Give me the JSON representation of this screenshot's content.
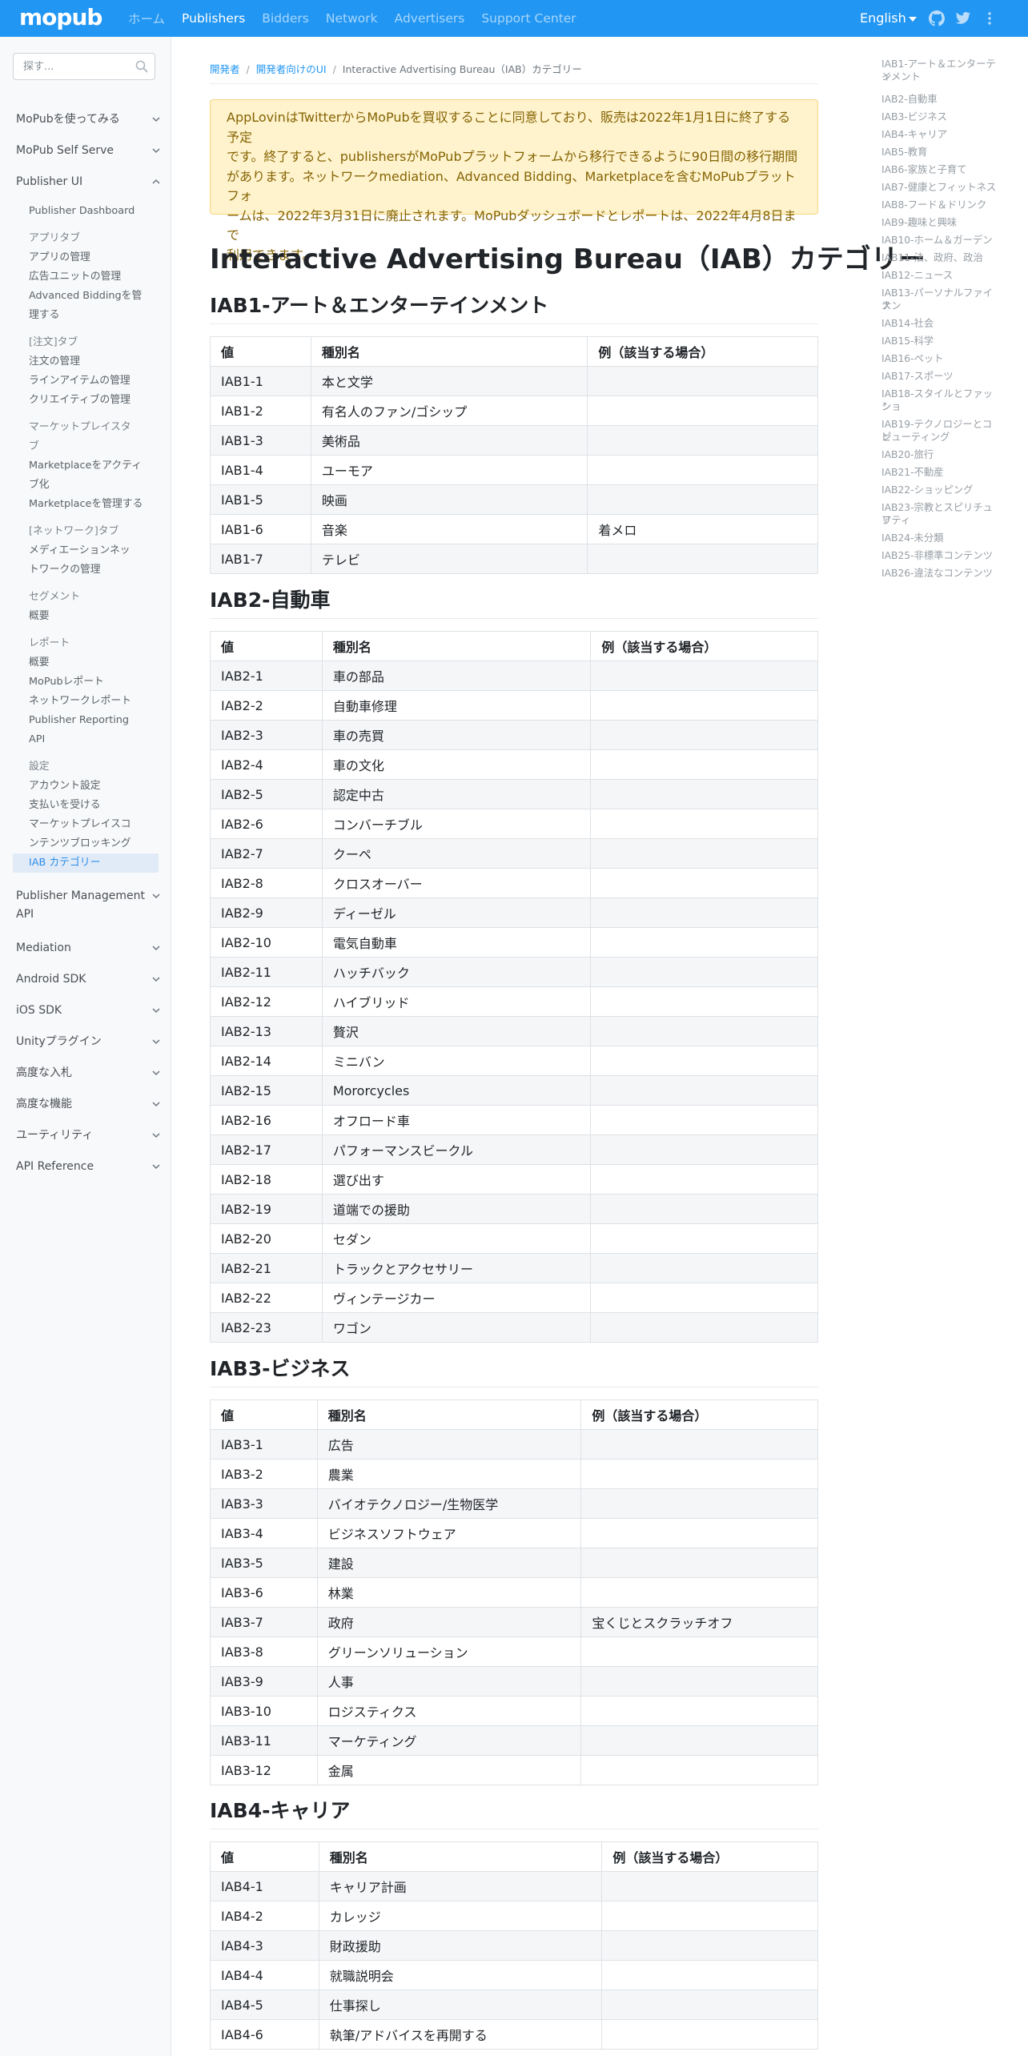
{
  "header": {
    "logo": "mopub",
    "nav": [
      "ホーム",
      "Publishers",
      "Bidders",
      "Network",
      "Advertisers",
      "Support Center"
    ],
    "active_nav": "Publishers",
    "language": "English",
    "icons": [
      "github-icon",
      "twitter-icon",
      "more-vertical-icon"
    ]
  },
  "sidebar": {
    "search_placeholder": "探す...",
    "sections_top": [
      "MoPubを使ってみる",
      "MoPub Self Serve",
      "Publisher UI"
    ],
    "items": [
      "Publisher Dashboard",
      "アプリタブ",
      "アプリの管理",
      "広告ユニットの管理",
      "Advanced Biddingを管",
      "理する",
      "[注文]タブ",
      "注文の管理",
      "ラインアイテムの管理",
      "クリエイティブの管理",
      "マーケットプレイスタ",
      "ブ",
      "Marketplaceをアクティ",
      "ブ化",
      "Marketplaceを管理する",
      "[ネットワーク]タブ",
      "メディエーションネッ",
      "トワークの管理",
      "セグメント",
      "概要",
      "レポート",
      "概要",
      "MoPubレポート",
      "ネットワークレポート",
      "Publisher Reporting",
      "API",
      "設定",
      "アカウント設定",
      "支払いを受ける",
      "マーケットプレイスコ",
      "ンテンツブロッキング",
      "IAB カテゴリー"
    ],
    "sections_bottom": [
      "Publisher Management",
      "API",
      "Mediation",
      "Android SDK",
      "iOS SDK",
      "Unityプラグイン",
      "高度な入札",
      "高度な機能",
      "ユーティリティ",
      "API Reference"
    ]
  },
  "breadcrumb": [
    "開発者",
    "開発者向けのUI",
    "Interactive Advertising Bureau（IAB）カテゴリー"
  ],
  "alert_lines": [
    "AppLovinはTwitterからMoPubを買収することに同意しており、販売は2022年1月1日に終了する予定",
    "です。終了すると、publishersがMoPubプラットフォームから移行できるように90日間の移行期間",
    "があります。ネットワークmediation、Advanced Bidding、Marketplaceを含むMoPubプラットフォ",
    "ームは、2022年3月31日に廃止されます。MoPubダッシュボードとレポートは、2022年4月8日まで",
    "利用できます。"
  ],
  "page_title": "Interactive Advertising Bureau（IAB）カテゴリー",
  "table_headers": [
    "値",
    "種別名",
    "例（該当する場合）"
  ],
  "tables": [
    {
      "title": "IAB1-アート＆エンターテインメント",
      "rows": [
        [
          "IAB1-1",
          "本と文学",
          ""
        ],
        [
          "IAB1-2",
          "有名人のファン/ゴシップ",
          ""
        ],
        [
          "IAB1-3",
          "美術品",
          ""
        ],
        [
          "IAB1-4",
          "ユーモア",
          ""
        ],
        [
          "IAB1-5",
          "映画",
          ""
        ],
        [
          "IAB1-6",
          "音楽",
          "着メロ"
        ],
        [
          "IAB1-7",
          "テレビ",
          ""
        ]
      ]
    },
    {
      "title": "IAB2-自動車",
      "rows": [
        [
          "IAB2-1",
          "車の部品",
          ""
        ],
        [
          "IAB2-2",
          "自動車修理",
          ""
        ],
        [
          "IAB2-3",
          "車の売買",
          ""
        ],
        [
          "IAB2-4",
          "車の文化",
          ""
        ],
        [
          "IAB2-5",
          "認定中古",
          ""
        ],
        [
          "IAB2-6",
          "コンバーチブル",
          ""
        ],
        [
          "IAB2-7",
          "クーペ",
          ""
        ],
        [
          "IAB2-8",
          "クロスオーバー",
          ""
        ],
        [
          "IAB2-9",
          "ディーゼル",
          ""
        ],
        [
          "IAB2-10",
          "電気自動車",
          ""
        ],
        [
          "IAB2-11",
          "ハッチバック",
          ""
        ],
        [
          "IAB2-12",
          "ハイブリッド",
          ""
        ],
        [
          "IAB2-13",
          "贅沢",
          ""
        ],
        [
          "IAB2-14",
          "ミニバン",
          ""
        ],
        [
          "IAB2-15",
          "Mororcycles",
          ""
        ],
        [
          "IAB2-16",
          "オフロード車",
          ""
        ],
        [
          "IAB2-17",
          "パフォーマンスビークル",
          ""
        ],
        [
          "IAB2-18",
          "選び出す",
          ""
        ],
        [
          "IAB2-19",
          "道端での援助",
          ""
        ],
        [
          "IAB2-20",
          "セダン",
          ""
        ],
        [
          "IAB2-21",
          "トラックとアクセサリー",
          ""
        ],
        [
          "IAB2-22",
          "ヴィンテージカー",
          ""
        ],
        [
          "IAB2-23",
          "ワゴン",
          ""
        ]
      ]
    },
    {
      "title": "IAB3-ビジネス",
      "rows": [
        [
          "IAB3-1",
          "広告",
          ""
        ],
        [
          "IAB3-2",
          "農業",
          ""
        ],
        [
          "IAB3-3",
          "バイオテクノロジー/生物医学",
          ""
        ],
        [
          "IAB3-4",
          "ビジネスソフトウェア",
          ""
        ],
        [
          "IAB3-5",
          "建設",
          ""
        ],
        [
          "IAB3-6",
          "林業",
          ""
        ],
        [
          "IAB3-7",
          "政府",
          "宝くじとスクラッチオフ"
        ],
        [
          "IAB3-8",
          "グリーンソリューション",
          ""
        ],
        [
          "IAB3-9",
          "人事",
          ""
        ],
        [
          "IAB3-10",
          "ロジスティクス",
          ""
        ],
        [
          "IAB3-11",
          "マーケティング",
          ""
        ],
        [
          "IAB3-12",
          "金属",
          ""
        ]
      ]
    },
    {
      "title": "IAB4-キャリア",
      "rows": [
        [
          "IAB4-1",
          "キャリア計画",
          ""
        ],
        [
          "IAB4-2",
          "カレッジ",
          ""
        ],
        [
          "IAB4-3",
          "財政援助",
          ""
        ],
        [
          "IAB4-4",
          "就職説明会",
          ""
        ],
        [
          "IAB4-5",
          "仕事探し",
          ""
        ],
        [
          "IAB4-6",
          "執筆/アドバイスを再開する",
          ""
        ]
      ]
    }
  ],
  "toc": [
    "IAB1-アート＆エンターテイ",
    "ンメント",
    "IAB2-自動車",
    "IAB3-ビジネス",
    "IAB4-キャリア",
    "IAB5-教育",
    "IAB6-家族と子育て",
    "IAB7-健康とフィットネス",
    "IAB8-フード＆ドリンク",
    "IAB9-趣味と興味",
    "IAB10-ホーム＆ガーデン",
    "IAB11-法、政府、政治",
    "IAB12-ニュース",
    "IAB13-パーソナルファイナン",
    "ス",
    "IAB14-社会",
    "IAB15-科学",
    "IAB16-ペット",
    "IAB17-スポーツ",
    "IAB18-スタイルとファッショ",
    "ン",
    "IAB19-テクノロジーとコン",
    "ピューティング",
    "IAB20-旅行",
    "IAB21-不動産",
    "IAB22-ショッピング",
    "IAB23-宗教とスピリチュア",
    "リティ",
    "IAB24-未分類",
    "IAB25-非標準コンテンツ",
    "IAB26-違法なコンテンツ"
  ]
}
